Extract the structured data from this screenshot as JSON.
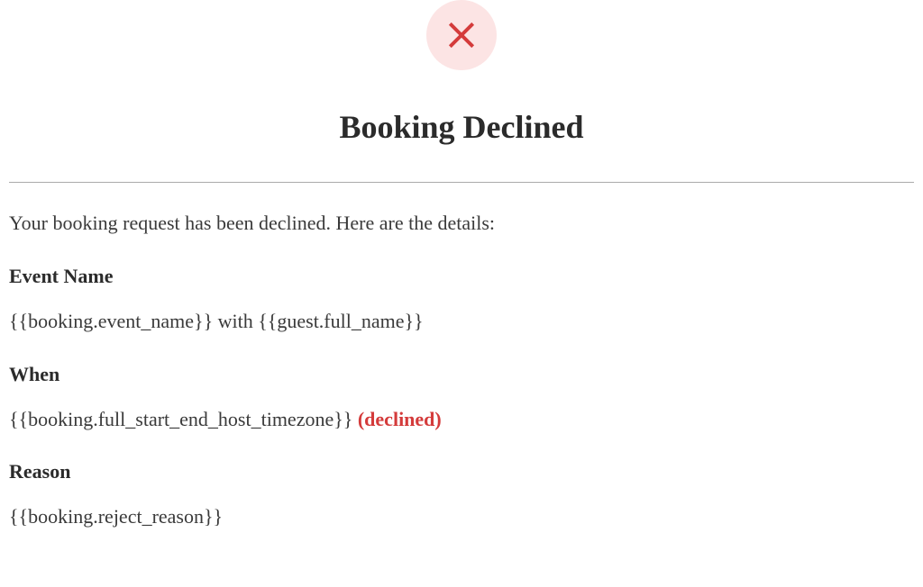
{
  "icon": "close-icon",
  "heading": "Booking Declined",
  "intro": "Your booking request has been declined. Here are the details:",
  "sections": {
    "event": {
      "label": "Event Name",
      "value": "{{booking.event_name}} with {{guest.full_name}}"
    },
    "when": {
      "label": "When",
      "value": "{{booking.full_start_end_host_timezone}}",
      "status": "(declined)"
    },
    "reason": {
      "label": "Reason",
      "value": "{{booking.reject_reason}}"
    }
  },
  "colors": {
    "accent_red": "#d43b3b",
    "icon_bg": "#fce4e4",
    "text": "#333333",
    "divider": "#aaaaaa"
  }
}
